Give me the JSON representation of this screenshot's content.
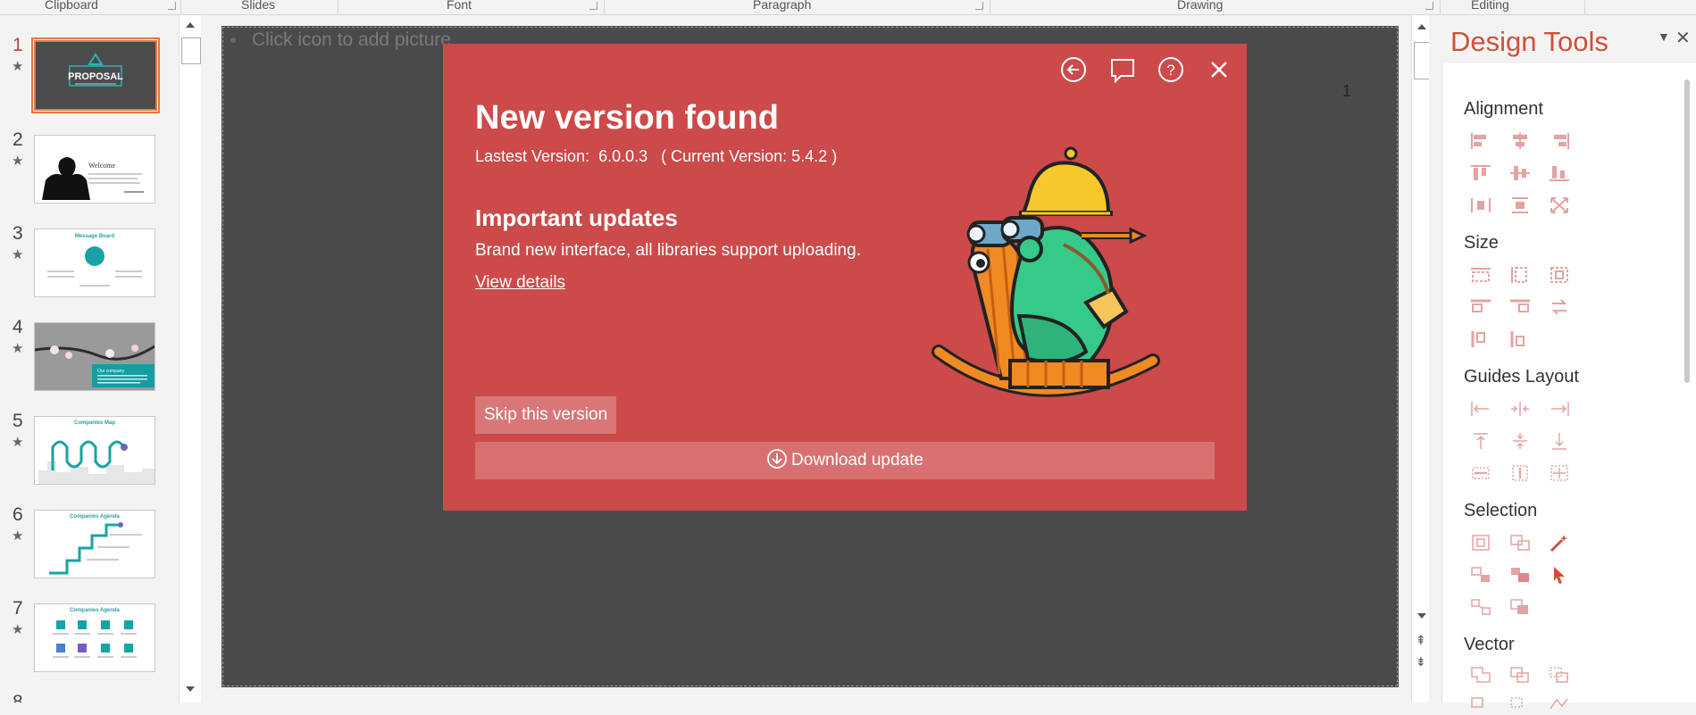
{
  "ribbon": {
    "groups": [
      "Clipboard",
      "Slides",
      "Font",
      "Paragraph",
      "Drawing",
      "Editing"
    ]
  },
  "thumbnails": [
    {
      "num": "1",
      "title": "PROPOSAL",
      "active": true
    },
    {
      "num": "2",
      "title": "Welcome",
      "active": false
    },
    {
      "num": "3",
      "title": "Message Board",
      "active": false
    },
    {
      "num": "4",
      "title": "Our company",
      "active": false
    },
    {
      "num": "5",
      "title": "Companies Map",
      "active": false
    },
    {
      "num": "6",
      "title": "Companies Agenda",
      "active": false
    },
    {
      "num": "7",
      "title": "Companies Agenda",
      "active": false
    }
  ],
  "slide": {
    "placeholder": "Click icon to add picture",
    "page_number": "1"
  },
  "dialog": {
    "title": "New version found",
    "version_line": "Lastest Version:  6.0.0.3   ( Current Version: 5.4.2 )",
    "section_title": "Important updates",
    "description": "Brand new interface, all libraries support uploading.",
    "link": "View details",
    "skip_button": "Skip this version",
    "download_button": "Download update",
    "icons": [
      "back-icon",
      "comment-icon",
      "help-icon",
      "close-icon"
    ],
    "bg_color": "#cc4a4a"
  },
  "pane": {
    "title": "Design Tools",
    "sections": [
      "Alignment",
      "Size",
      "Guides Layout",
      "Selection",
      "Vector"
    ],
    "accent_color": "#d0503a"
  }
}
